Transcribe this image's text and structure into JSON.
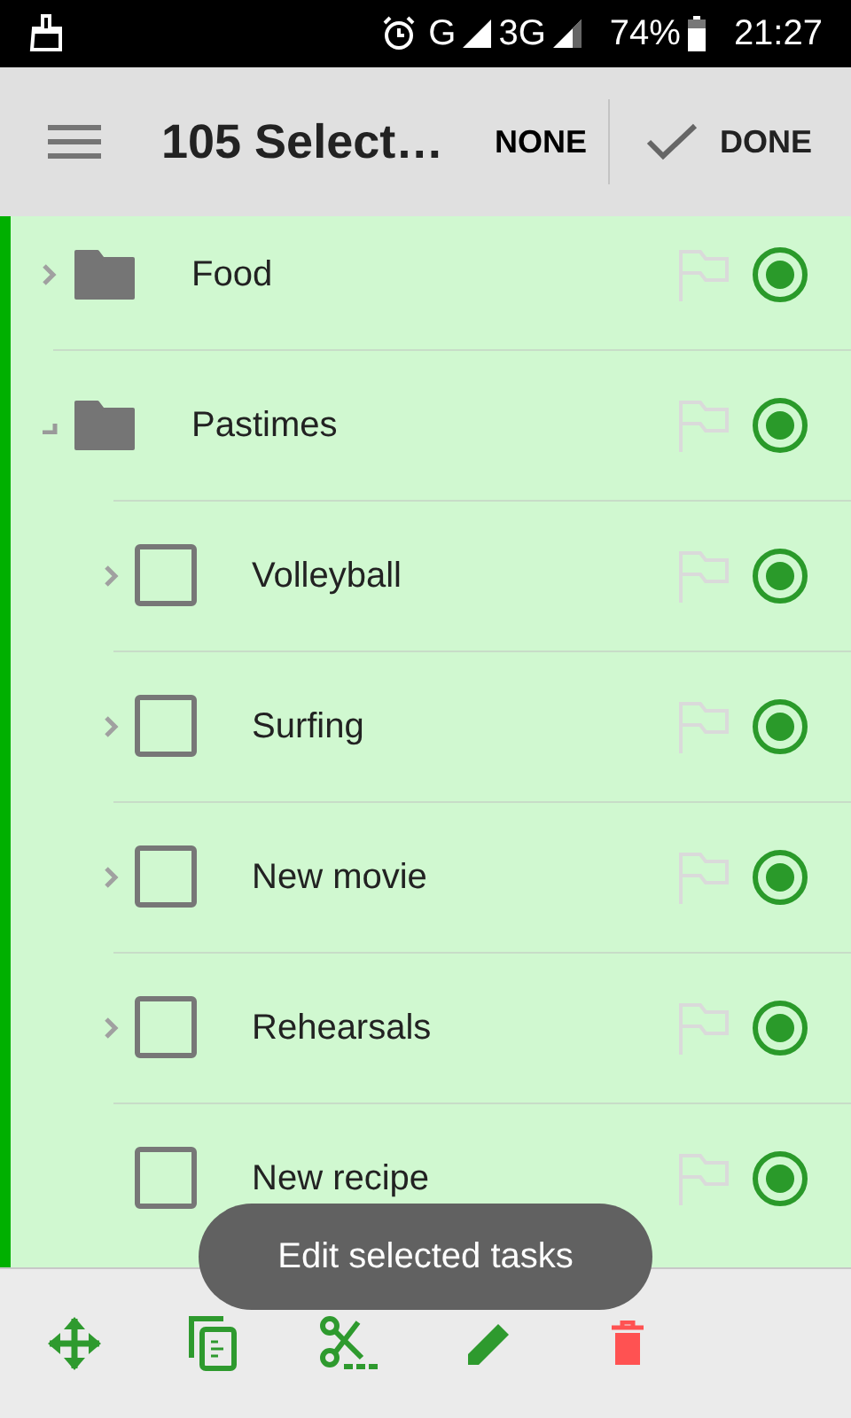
{
  "status_bar": {
    "network_1": "G",
    "network_2": "3G",
    "battery": "74%",
    "time": "21:27"
  },
  "toolbar": {
    "title": "105 Select…",
    "none_button": "NONE",
    "done_button": "DONE"
  },
  "tasks": [
    {
      "kind": "folder",
      "title": "Food",
      "expandable": true,
      "expanded": false,
      "flagged": false,
      "selected": true
    },
    {
      "kind": "folder",
      "title": "Pastimes",
      "expandable": true,
      "expanded": true,
      "flagged": false,
      "selected": true,
      "children": [
        {
          "kind": "task",
          "title": "Volleyball",
          "checked": false,
          "expandable": true,
          "expanded": false,
          "flagged": false,
          "selected": true
        },
        {
          "kind": "task",
          "title": "Surfing",
          "checked": false,
          "expandable": true,
          "expanded": false,
          "flagged": false,
          "selected": true
        },
        {
          "kind": "task",
          "title": "New movie",
          "checked": false,
          "expandable": true,
          "expanded": false,
          "flagged": false,
          "selected": true
        },
        {
          "kind": "task",
          "title": "Rehearsals",
          "checked": false,
          "expandable": true,
          "expanded": false,
          "flagged": false,
          "selected": true
        },
        {
          "kind": "task",
          "title": "New recipe",
          "checked": false,
          "expandable": false,
          "flagged": false,
          "selected": true
        }
      ]
    }
  ],
  "toast": "Edit selected tasks",
  "bottom_actions": [
    {
      "kind": "move"
    },
    {
      "kind": "copy"
    },
    {
      "kind": "cut"
    },
    {
      "kind": "edit"
    },
    {
      "kind": "delete"
    }
  ]
}
